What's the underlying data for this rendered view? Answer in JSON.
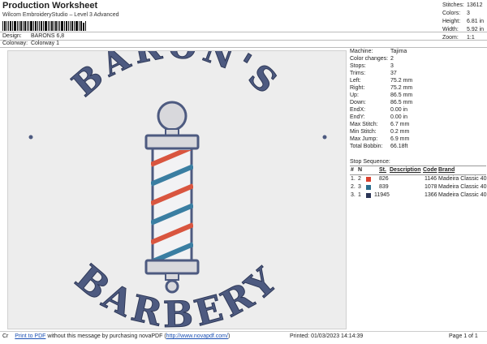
{
  "header": {
    "title": "Production Worksheet",
    "subtitle": "Wilcom EmbroideryStudio – Level 3 Advanced",
    "design_label": "Design:",
    "design_value": "BARONS 6,8",
    "colorway_label": "Colorway:",
    "colorway_value": "Colorway 1"
  },
  "stats": [
    {
      "label": "Stitches:",
      "value": "13612"
    },
    {
      "label": "Colors:",
      "value": "3"
    },
    {
      "label": "Height:",
      "value": "6.81 in"
    },
    {
      "label": "Width:",
      "value": "5.92 in"
    },
    {
      "label": "Zoom:",
      "value": "1:1"
    }
  ],
  "info": [
    {
      "label": "Machine:",
      "value": "Tajima"
    },
    {
      "label": "Color changes:",
      "value": "2"
    },
    {
      "label": "Stops:",
      "value": "3"
    },
    {
      "label": "Trims:",
      "value": "37"
    },
    {
      "label": "Left:",
      "value": "75.2 mm"
    },
    {
      "label": "Right:",
      "value": "75.2 mm"
    },
    {
      "label": "Up:",
      "value": "86.5 mm"
    },
    {
      "label": "Down:",
      "value": "86.5 mm"
    },
    {
      "label": "EndX:",
      "value": "0.00 in"
    },
    {
      "label": "EndY:",
      "value": "0.00 in"
    },
    {
      "label": "Max Stitch:",
      "value": "6.7 mm"
    },
    {
      "label": "Min Stitch:",
      "value": "0.2 mm"
    },
    {
      "label": "Max Jump:",
      "value": "6.9 mm"
    },
    {
      "label": "Total Bobbin:",
      "value": "66.18ft"
    }
  ],
  "stop_sequence": {
    "title": "Stop Sequence:",
    "columns": [
      "#",
      "N",
      "",
      "",
      "St.",
      "Description",
      "Code",
      "Brand"
    ],
    "rows": [
      {
        "num": "1.",
        "n": "2",
        "color": "#d9412f",
        "code_id": "826",
        "stitches": "1146",
        "brand": "Madeira Classic 40"
      },
      {
        "num": "2.",
        "n": "3",
        "color": "#2a6d8e",
        "code_id": "839",
        "stitches": "1078",
        "brand": "Madeira Classic 40"
      },
      {
        "num": "3.",
        "n": "1",
        "color": "#2b3556",
        "code_id": "11945",
        "stitches": "1366",
        "brand": "Madeira Classic 40"
      }
    ]
  },
  "design": {
    "top_text": "BARON'S",
    "bottom_text": "BARBERY",
    "thread_navy": "#4d5a80",
    "thread_red": "#d9553f",
    "thread_blue": "#3a7ea2"
  },
  "footer": {
    "prefix": "Cr",
    "link_text": "Print to PDF",
    "middle": " without this message by purchasing novaPDF (",
    "url_text": "http://www.novapdf.com/",
    "suffix": ")",
    "printed": "Printed: 01/03/2023 14:14:39",
    "page": "Page 1 of 1"
  }
}
